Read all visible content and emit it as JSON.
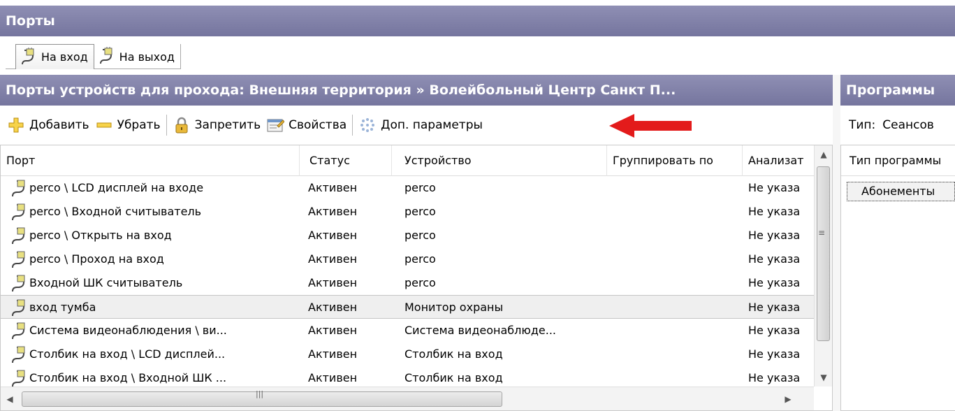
{
  "window": {
    "title": "Порты"
  },
  "tabs": [
    {
      "label": "На вход",
      "active": true,
      "icon": "port-plug-icon"
    },
    {
      "label": "На выход",
      "active": false,
      "icon": "port-plug-icon"
    }
  ],
  "left_panel": {
    "title": "Порты устройств для прохода: Внешняя территория » Волейбольный Центр Санкт П...",
    "toolbar": {
      "add_label": "Добавить",
      "remove_label": "Убрать",
      "deny_label": "Запретить",
      "properties_label": "Свойства",
      "extra_params_label": "Доп. параметры"
    },
    "columns": {
      "port": "Порт",
      "status": "Статус",
      "device": "Устройство",
      "group_by": "Группировать по",
      "analyzer": "Анализат"
    },
    "rows": [
      {
        "port": "perco \\ LCD дисплей на входе",
        "status": "Активен",
        "device": "perco",
        "group_by": "",
        "analyzer": "Не указа",
        "selected": false
      },
      {
        "port": "perco \\ Входной считыватель",
        "status": "Активен",
        "device": "perco",
        "group_by": "",
        "analyzer": "Не указа",
        "selected": false
      },
      {
        "port": "perco \\ Открыть на вход",
        "status": "Активен",
        "device": "perco",
        "group_by": "",
        "analyzer": "Не указа",
        "selected": false
      },
      {
        "port": "perco \\ Проход на вход",
        "status": "Активен",
        "device": "perco",
        "group_by": "",
        "analyzer": "Не указа",
        "selected": false
      },
      {
        "port": "Входной ШК считыватель",
        "status": "Активен",
        "device": "perco",
        "group_by": "",
        "analyzer": "Не указа",
        "selected": false
      },
      {
        "port": "вход тумба",
        "status": "Активен",
        "device": "Монитор охраны",
        "group_by": "",
        "analyzer": "Не указа",
        "selected": true
      },
      {
        "port": "Система видеонаблюдения \\ ви...",
        "status": "Активен",
        "device": "Система видеонаблюде...",
        "group_by": "",
        "analyzer": "Не указа",
        "selected": false
      },
      {
        "port": "Столбик на вход \\ LCD дисплей...",
        "status": "Активен",
        "device": "Столбик на вход",
        "group_by": "",
        "analyzer": "Не указа",
        "selected": false
      },
      {
        "port": "Столбик на вход \\ Входной ШК ...",
        "status": "Активен",
        "device": "Столбик на вход",
        "group_by": "",
        "analyzer": "Не указа",
        "selected": false
      }
    ]
  },
  "right_panel": {
    "title": "Программы",
    "type_label": "Тип:",
    "type_value": "Сеансов",
    "column_header": "Тип программы",
    "items": [
      {
        "label": "Абонементы"
      }
    ]
  },
  "colors": {
    "header_bg": "#8383aa",
    "annotation_arrow": "#e31b1b"
  }
}
